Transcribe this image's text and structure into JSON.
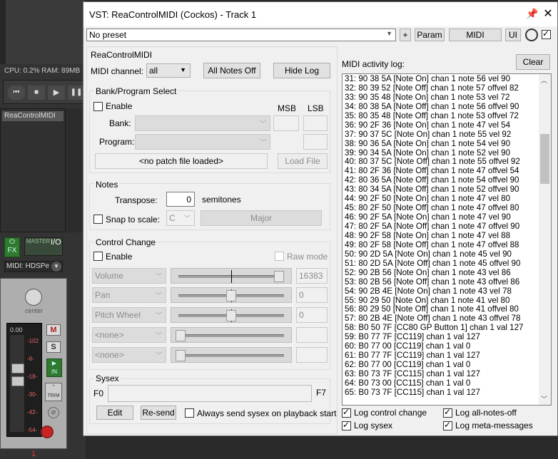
{
  "daw": {
    "cpu_text": "CPU: 0.2%  RAM: 89MB",
    "fx_chain_item": "ReaControlMIDI",
    "fx_label": "FX",
    "io_label": "I/O",
    "master_label": "MASTER",
    "midi_input_label": "MIDI: HDSPe",
    "pan_label": "center",
    "volume_readout": "0.00",
    "meter_ticks": [
      "-102",
      "-6-",
      "-18-",
      "-30-",
      "-42-",
      "-54-"
    ],
    "mute_label": "M",
    "solo_label": "S",
    "input_label": "IN",
    "trim_label": "TRIM",
    "track_number": "1"
  },
  "window": {
    "title": "VST: ReaControlMIDI (Cockos) - Track 1",
    "preset_value": "No preset",
    "plus_label": "+",
    "param_label": "Param",
    "midi_label": "MIDI",
    "ui_label": "UI"
  },
  "plugin": {
    "header": "ReaControlMIDI",
    "midi_channel_label": "MIDI channel:",
    "midi_channel_value": "all",
    "all_notes_off_label": "All Notes Off",
    "hide_log_label": "Hide Log",
    "bank_group_label": "Bank/Program Select",
    "enable_label": "Enable",
    "msb_label": "MSB",
    "lsb_label": "LSB",
    "bank_label": "Bank:",
    "program_label": "Program:",
    "patch_file_text": "<no patch file loaded>",
    "load_file_label": "Load File",
    "notes_group_label": "Notes",
    "transpose_label": "Transpose:",
    "transpose_value": "0",
    "semitones_label": "semitones",
    "snap_label": "Snap to scale:",
    "scale_key": "C",
    "scale_name": "Major",
    "cc_group_label": "Control Change",
    "cc_enable_label": "Enable",
    "raw_mode_label": "Raw mode",
    "cc_rows": [
      {
        "name": "Volume",
        "value": "16383",
        "position": 0.97,
        "bipolar": true
      },
      {
        "name": "Pan",
        "value": "0",
        "position": 0.5,
        "bipolar": true
      },
      {
        "name": "Pitch Wheel",
        "value": "0",
        "position": 0.5,
        "bipolar": true
      },
      {
        "name": "<none>",
        "value": "",
        "position": 0.0,
        "bipolar": false
      },
      {
        "name": "<none>",
        "value": "",
        "position": 0.0,
        "bipolar": false
      }
    ],
    "sysex_group_label": "Sysex",
    "f0_label": "F0",
    "f7_label": "F7",
    "edit_label": "Edit",
    "resend_label": "Re-send",
    "always_send_label": "Always send sysex on playback start"
  },
  "log": {
    "title": "MIDI activity log:",
    "clear_label": "Clear",
    "lines": [
      "31: 90 38 5A [Note On] chan 1 note 56 vel 90",
      "32: 80 39 52 [Note Off] chan 1 note 57 offvel 82",
      "33: 90 35 48 [Note On] chan 1 note 53 vel 72",
      "34: 80 38 5A [Note Off] chan 1 note 56 offvel 90",
      "35: 80 35 48 [Note Off] chan 1 note 53 offvel 72",
      "36: 90 2F 36 [Note On] chan 1 note 47 vel 54",
      "37: 90 37 5C [Note On] chan 1 note 55 vel 92",
      "38: 90 36 5A [Note On] chan 1 note 54 vel 90",
      "39: 90 34 5A [Note On] chan 1 note 52 vel 90",
      "40: 80 37 5C [Note Off] chan 1 note 55 offvel 92",
      "41: 80 2F 36 [Note Off] chan 1 note 47 offvel 54",
      "42: 80 36 5A [Note Off] chan 1 note 54 offvel 90",
      "43: 80 34 5A [Note Off] chan 1 note 52 offvel 90",
      "44: 90 2F 50 [Note On] chan 1 note 47 vel 80",
      "45: 80 2F 50 [Note Off] chan 1 note 47 offvel 80",
      "46: 90 2F 5A [Note On] chan 1 note 47 vel 90",
      "47: 80 2F 5A [Note Off] chan 1 note 47 offvel 90",
      "48: 90 2F 58 [Note On] chan 1 note 47 vel 88",
      "49: 80 2F 58 [Note Off] chan 1 note 47 offvel 88",
      "50: 90 2D 5A [Note On] chan 1 note 45 vel 90",
      "51: 80 2D 5A [Note Off] chan 1 note 45 offvel 90",
      "52: 90 2B 56 [Note On] chan 1 note 43 vel 86",
      "53: 80 2B 56 [Note Off] chan 1 note 43 offvel 86",
      "54: 90 2B 4E [Note On] chan 1 note 43 vel 78",
      "55: 90 29 50 [Note On] chan 1 note 41 vel 80",
      "56: 80 29 50 [Note Off] chan 1 note 41 offvel 80",
      "57: 80 2B 4E [Note Off] chan 1 note 43 offvel 78",
      "58: B0 50 7F [CC80 GP Button 1] chan 1 val 127",
      "59: B0 77 7F [CC119] chan 1 val 127",
      "60: B0 77 00 [CC119] chan 1 val 0",
      "61: B0 77 7F [CC119] chan 1 val 127",
      "62: B0 77 00 [CC119] chan 1 val 0",
      "63: B0 73 7F [CC115] chan 1 val 127",
      "64: B0 73 00 [CC115] chan 1 val 0",
      "65: B0 73 7F [CC115] chan 1 val 127"
    ],
    "log_cc_label": "Log control change",
    "log_all_notes_off_label": "Log all-notes-off",
    "log_sysex_label": "Log sysex",
    "log_meta_label": "Log meta-messages",
    "log_cc_checked": true,
    "log_all_notes_off_checked": true,
    "log_sysex_checked": true,
    "log_meta_checked": true
  }
}
